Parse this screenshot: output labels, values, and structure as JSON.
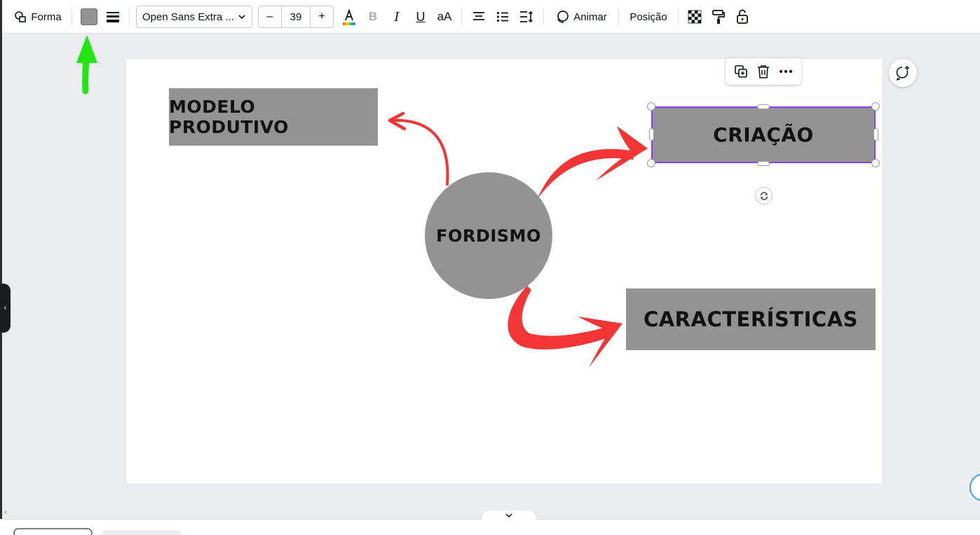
{
  "toolbar": {
    "shape_label": "Forma",
    "fill_color": "#939393",
    "font_name": "Open Sans Extra ...",
    "font_size": "39",
    "size_decrease": "–",
    "size_increase": "+",
    "case_label": "aA",
    "animate_label": "Animar",
    "position_label": "Posição"
  },
  "design": {
    "center_text": "FORDISMO",
    "box_top_left": "MODELO PRODUTIVO",
    "box_top_right": "CRIAÇÃO",
    "box_bottom_right": "CARACTERÍSTICAS",
    "shape_color": "#939393",
    "arrow_color": "#f23535"
  },
  "annotation": {
    "arrow_color": "#22e60f"
  },
  "selection": {
    "color": "#8b3dff"
  }
}
